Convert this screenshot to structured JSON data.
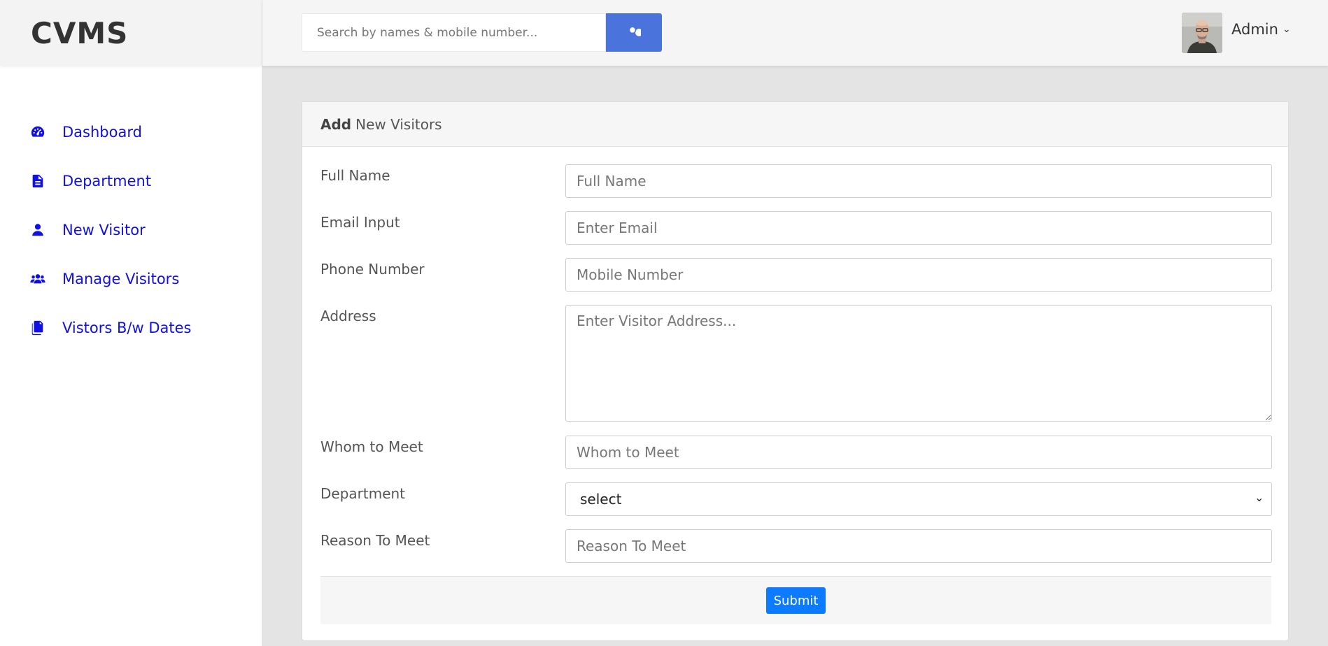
{
  "brand": "CVMS",
  "search": {
    "placeholder": "Search by names & mobile number...",
    "icon": "search-icon"
  },
  "user": {
    "name": "Admin",
    "chevron": "⌄"
  },
  "sidebar": {
    "items": [
      {
        "label": "Dashboard",
        "icon": "dashboard-icon"
      },
      {
        "label": "Department",
        "icon": "document-icon"
      },
      {
        "label": "New Visitor",
        "icon": "user-icon"
      },
      {
        "label": "Manage Visitors",
        "icon": "users-icon"
      },
      {
        "label": "Vistors B/w Dates",
        "icon": "files-icon"
      }
    ]
  },
  "form": {
    "title_bold": "Add",
    "title_rest": "New Visitors",
    "fields": [
      {
        "label": "Full Name",
        "placeholder": "Full Name"
      },
      {
        "label": "Email Input",
        "placeholder": "Enter Email"
      },
      {
        "label": "Phone Number",
        "placeholder": "Mobile Number"
      },
      {
        "label": "Address",
        "placeholder": "Enter Visitor Address..."
      },
      {
        "label": "Whom to Meet",
        "placeholder": "Whom to Meet"
      },
      {
        "label": "Department",
        "selected": "select"
      },
      {
        "label": "Reason To Meet",
        "placeholder": "Reason To Meet"
      }
    ],
    "submit_label": "Submit"
  },
  "colors": {
    "nav_link": "#1010e6",
    "search_button": "#4a73dc",
    "submit_button": "#0d7bff"
  }
}
